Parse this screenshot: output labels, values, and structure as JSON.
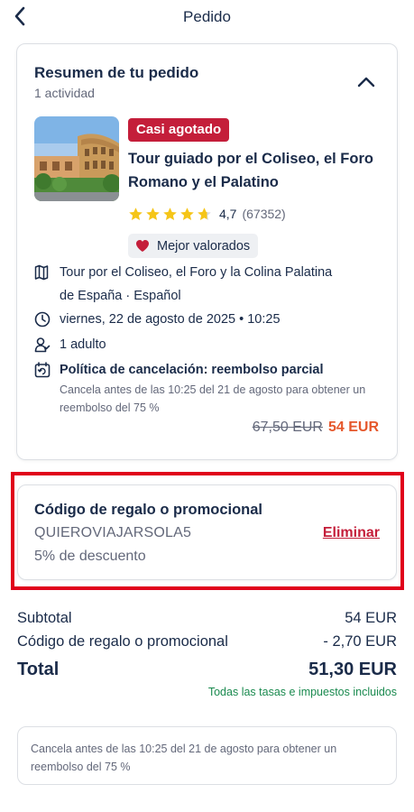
{
  "header": {
    "title": "Pedido"
  },
  "summary": {
    "title": "Resumen de tu pedido",
    "count": "1 actividad",
    "badge": "Casi agotado",
    "tour_title": "Tour guiado por el Coliseo, el Foro Romano y el Palatino",
    "rating": "4,7",
    "reviews": "(67352)",
    "stars_value": 4.7,
    "stars_max": 5,
    "best_badge": "Mejor valorados",
    "option_line1": "Tour por el Coliseo, el Foro y la Colina Palatina",
    "option_line2": "de España · Español",
    "date": "viernes, 22 de agosto de 2025 • 10:25",
    "participants": "1 adulto",
    "cancel_policy": "Política de cancelación: reembolso parcial",
    "cancel_note": "Cancela antes de las 10:25 del 21 de agosto para obtener un reembolso del 75 %",
    "old_price": "67,50 EUR",
    "new_price": "54 EUR"
  },
  "promo": {
    "title": "Código de regalo o promocional",
    "code": "QUIEROVIAJARSOLA5",
    "remove_label": "Eliminar",
    "discount": "5% de descuento"
  },
  "totals": {
    "subtotal_label": "Subtotal",
    "subtotal_value": "54 EUR",
    "promo_label": "Código de regalo o promocional",
    "promo_value": "- 2,70 EUR",
    "total_label": "Total",
    "total_value": "51,30 EUR",
    "taxes_note": "Todas las tasas e impuestos incluidos"
  },
  "footer": {
    "cancel_note": "Cancela antes de las 10:25 del 21 de agosto para obtener un reembolso del 75 %"
  },
  "colors": {
    "brand_text": "#1a2b49",
    "badge_red": "#c41e3a",
    "price_orange": "#e5572b",
    "star_gold": "#f5c518",
    "tax_green": "#1a8a4f",
    "highlight_red": "#e0001b"
  },
  "icons": {
    "back": "chevron-left-icon",
    "collapse": "chevron-up-icon",
    "best": "heart-icon",
    "option": "map-icon",
    "date": "clock-icon",
    "participants": "person-icon",
    "cancel": "calendar-refund-icon"
  }
}
